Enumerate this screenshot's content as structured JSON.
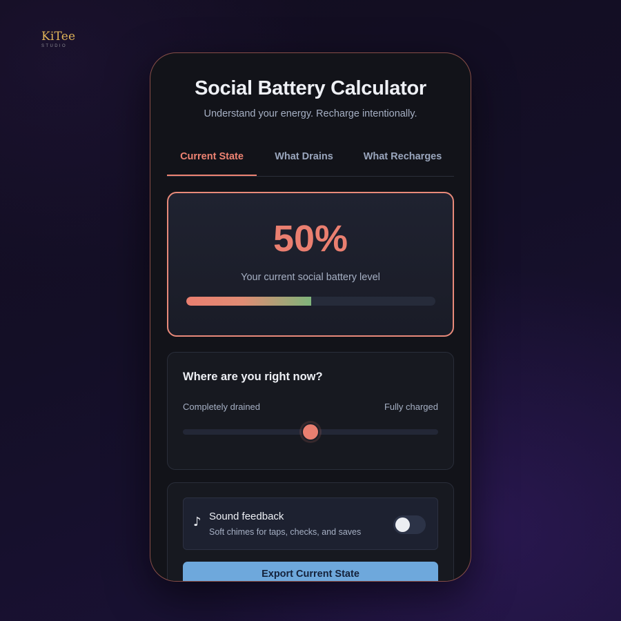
{
  "brand": {
    "name": "KiTee",
    "subtitle": "STUDIO"
  },
  "app": {
    "title": "Social Battery Calculator",
    "subtitle": "Understand your energy. Recharge intentionally."
  },
  "tabs": [
    {
      "label": "Current State",
      "active": true
    },
    {
      "label": "What Drains",
      "active": false
    },
    {
      "label": "What Recharges",
      "active": false
    }
  ],
  "battery": {
    "percent_label": "50%",
    "level": 0.5,
    "description": "Your current social battery level"
  },
  "slider_section": {
    "title": "Where are you right now?",
    "min_label": "Completely drained",
    "max_label": "Fully charged",
    "value": 0.5
  },
  "sound": {
    "icon": "music-note-icon",
    "glyph": "♪",
    "title": "Sound feedback",
    "subtitle": "Soft chimes for taps, checks, and saves",
    "enabled": false
  },
  "export": {
    "label": "Export Current State"
  },
  "colors": {
    "accent": "#ea7f70",
    "positive": "#7fb47a",
    "button": "#6ea8dc",
    "brand": "#e0b458"
  }
}
